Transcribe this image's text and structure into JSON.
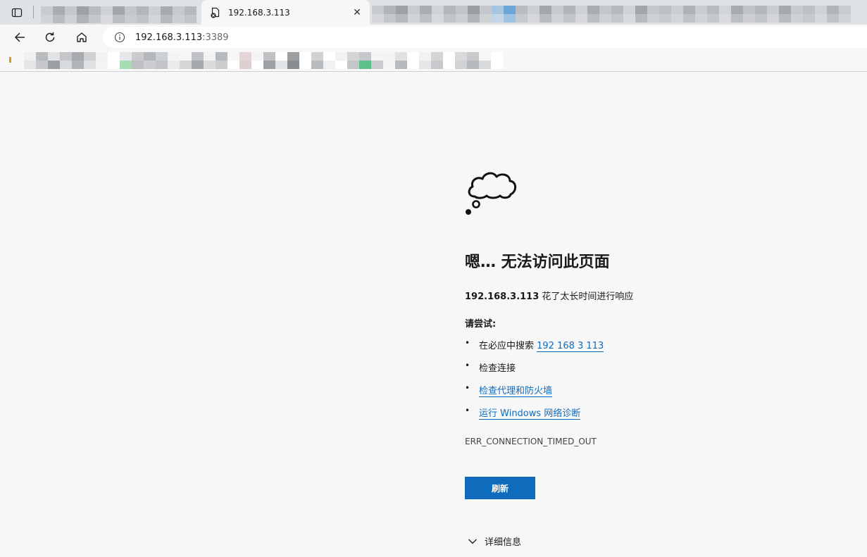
{
  "tabs": {
    "active_title": "192.168.3.113",
    "close_label": "✕"
  },
  "toolbar": {
    "url_host": "192.168.3.113",
    "url_port": ":3389"
  },
  "error": {
    "heading": "嗯… 无法访问此页面",
    "host": "192.168.3.113",
    "message": " 花了太长时间进行响应",
    "try_label": "请尝试:",
    "tips": {
      "search_prefix": "在必应中搜索 ",
      "search_link": "192 168 3 113",
      "check_connection": "检查连接",
      "check_proxy": "检查代理和防火墙",
      "run_diagnostics": "运行 Windows 网络诊断"
    },
    "code": "ERR_CONNECTION_TIMED_OUT",
    "refresh_label": "刷新",
    "details_label": "详细信息"
  },
  "colors": {
    "accent": "#0f6cbd",
    "page_bg": "#f7f7f7",
    "tabstrip_bg": "#dfe3e8"
  }
}
